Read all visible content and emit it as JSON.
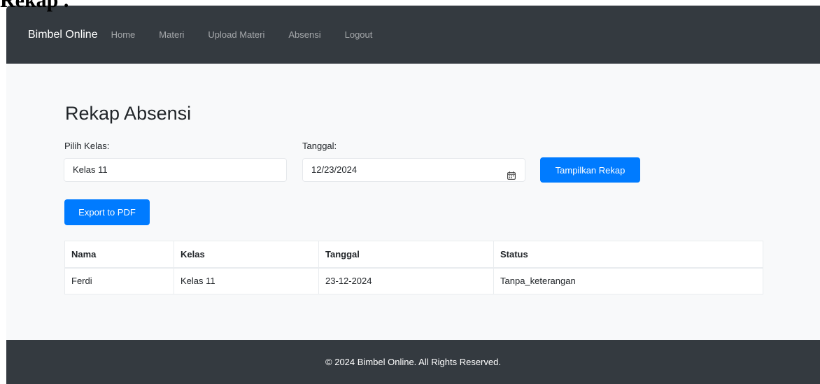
{
  "overlay_caption": "Rekap .",
  "navbar": {
    "brand": "Bimbel Online",
    "links": [
      "Home",
      "Materi",
      "Upload Materi",
      "Absensi",
      "Logout"
    ]
  },
  "page": {
    "title": "Rekap Absensi",
    "kelas_label": "Pilih Kelas:",
    "kelas_value": "Kelas 11",
    "tanggal_label": "Tanggal:",
    "tanggal_value": "12/23/2024",
    "tampilkan_label": "Tampilkan Rekap",
    "export_label": "Export to PDF"
  },
  "table": {
    "headers": [
      "Nama",
      "Kelas",
      "Tanggal",
      "Status"
    ],
    "rows": [
      [
        "Ferdi",
        "Kelas 11",
        "23-12-2024",
        "Tanpa_keterangan"
      ]
    ]
  },
  "footer": {
    "text": "© 2024 Bimbel Online. All Rights Reserved."
  },
  "colors": {
    "navbar_bg": "#343a40",
    "page_bg": "#f8f9fa",
    "primary": "#007bff",
    "footer_bg": "#343a40"
  },
  "icons": {
    "date_picker": "calendar-icon"
  }
}
